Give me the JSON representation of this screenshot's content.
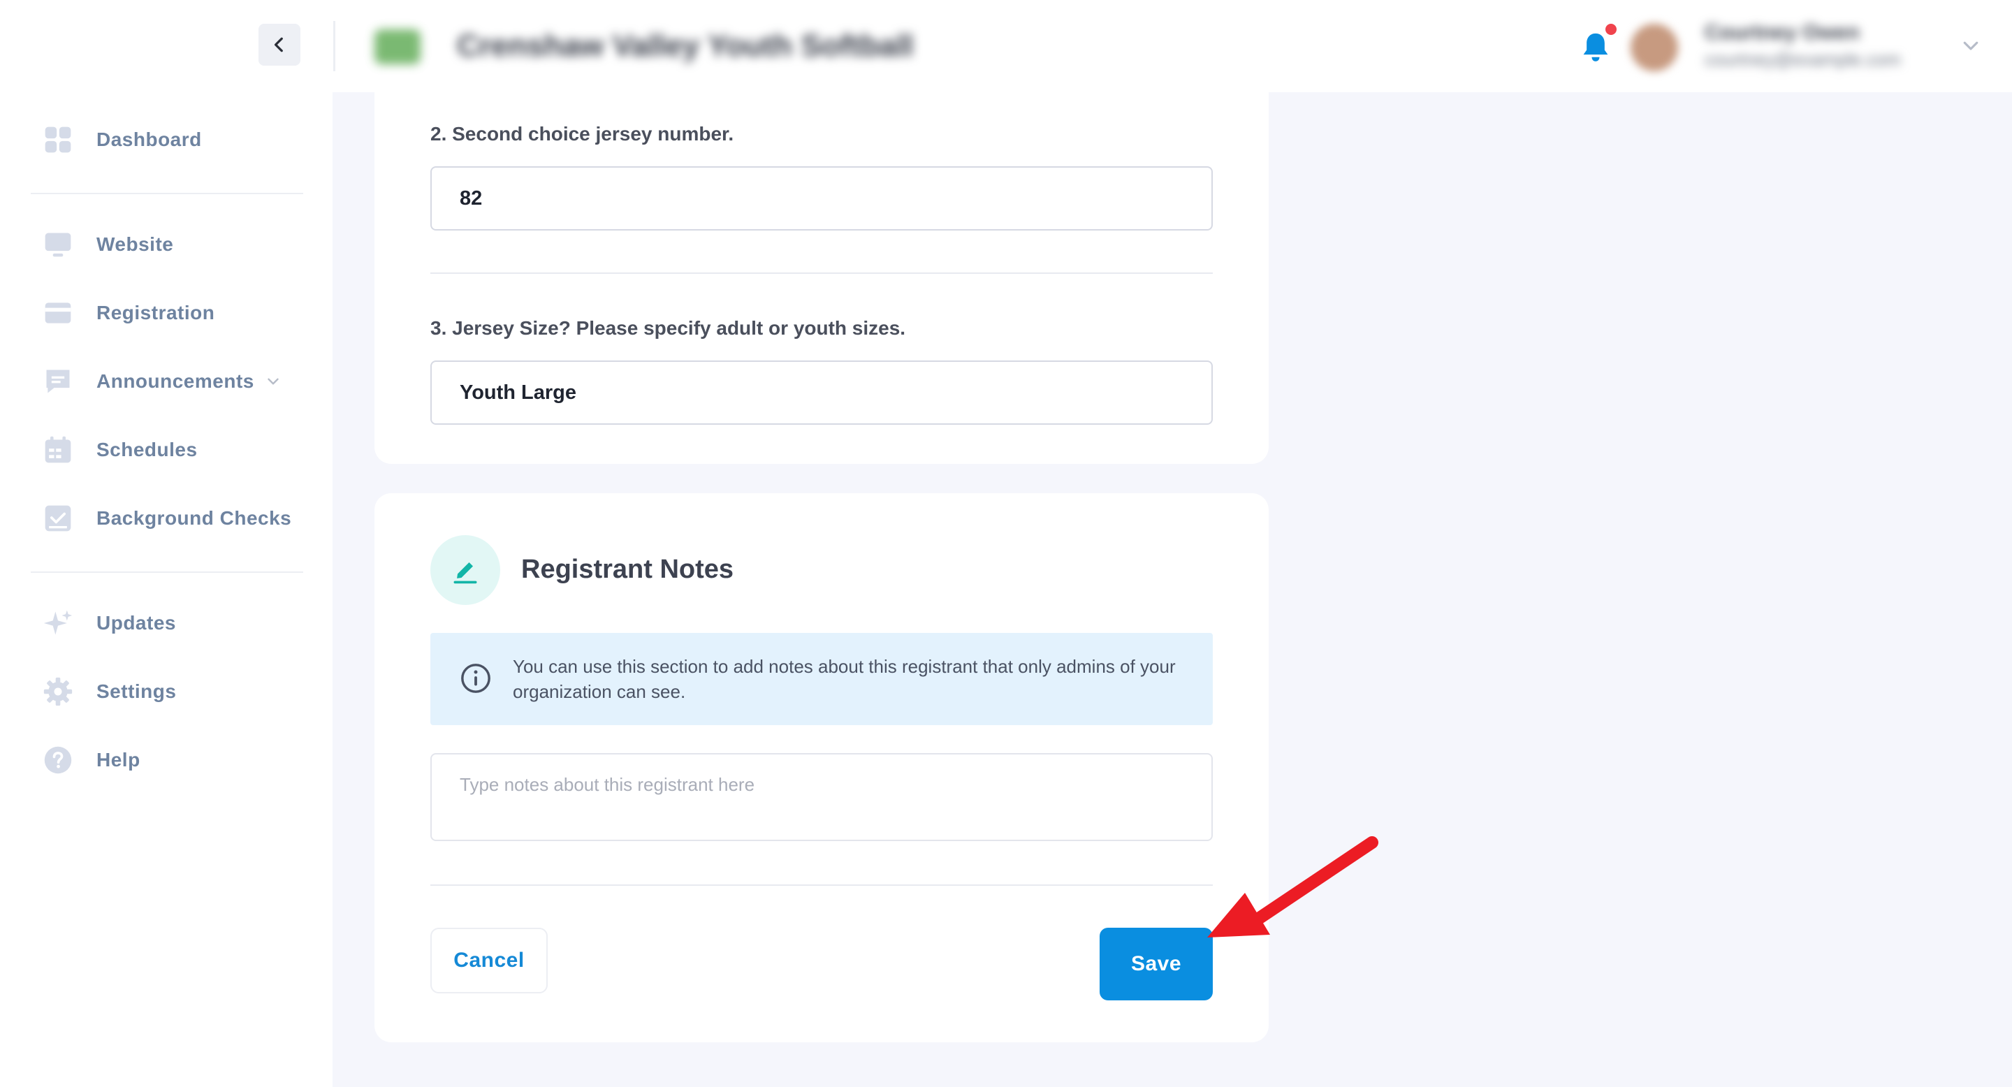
{
  "header": {
    "org_name": "Crenshaw Valley Youth Softball",
    "user_name": "Courtney Owen",
    "user_email": "courtney@example.com"
  },
  "sidebar": {
    "items": [
      {
        "label": "Dashboard",
        "icon": "dashboard-icon"
      },
      {
        "label": "Website",
        "icon": "monitor-icon"
      },
      {
        "label": "Registration",
        "icon": "card-icon"
      },
      {
        "label": "Announcements",
        "icon": "message-icon"
      },
      {
        "label": "Schedules",
        "icon": "calendar-icon"
      },
      {
        "label": "Background Checks",
        "icon": "checkbox-icon"
      },
      {
        "label": "Updates",
        "icon": "sparkle-icon"
      },
      {
        "label": "Settings",
        "icon": "gear-icon"
      },
      {
        "label": "Help",
        "icon": "help-icon"
      }
    ]
  },
  "questions": [
    {
      "label": "2. Second choice jersey number.",
      "value": "82"
    },
    {
      "label": "3. Jersey Size? Please specify adult or youth sizes.",
      "value": "Youth Large"
    }
  ],
  "notes": {
    "title": "Registrant Notes",
    "info": "You can use this section to add notes about this registrant that only admins of your organization can see.",
    "placeholder": "Type notes about this registrant here",
    "cancel_label": "Cancel",
    "save_label": "Save"
  },
  "colors": {
    "accent": "#0a8ee0",
    "nav_text": "#6e83a0",
    "notification": "#f0434d",
    "notes_icon": "#12b5a7",
    "info_bg": "#e3f2fd",
    "annotation": "#ec1c24"
  }
}
